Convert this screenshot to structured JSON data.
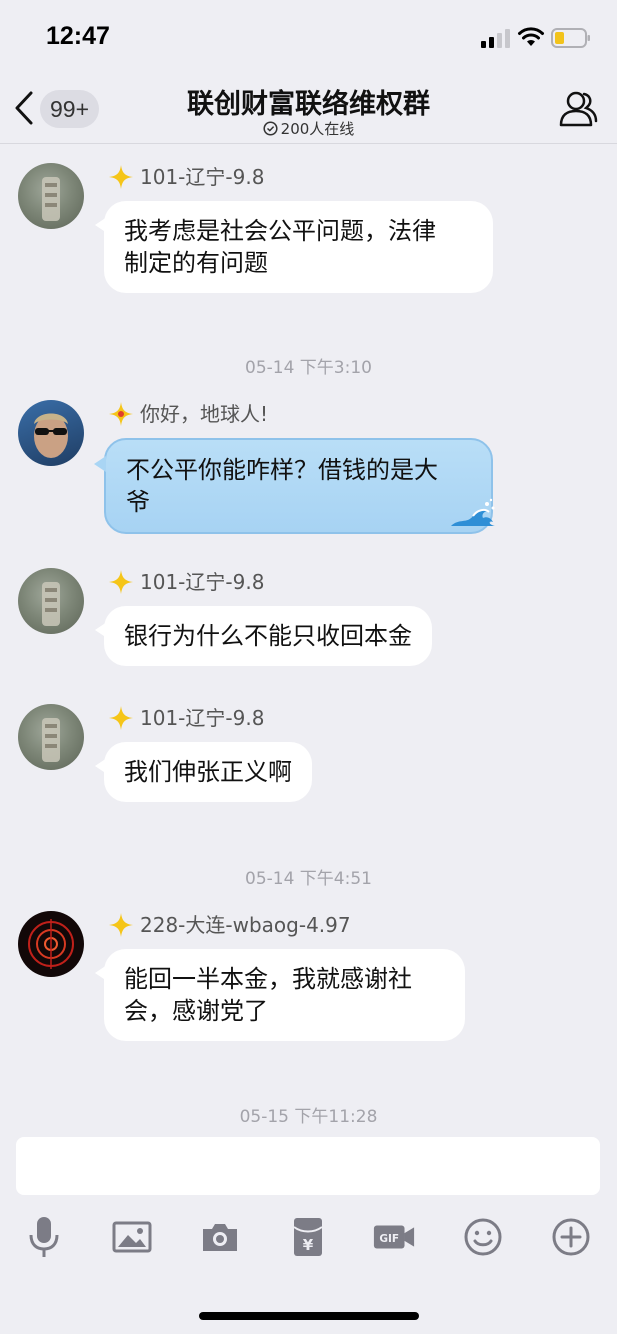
{
  "status_bar": {
    "time": "12:47"
  },
  "header": {
    "unread": "99+",
    "title": "联创财富联络维权群",
    "online": "200人在线"
  },
  "messages": [
    {
      "sender": "101-辽宁-9.8",
      "lines": [
        "我考虑是社会公平问题，法律",
        "制定的有问题"
      ],
      "style": "white"
    },
    {
      "timestamp": "05-14 下午3:10"
    },
    {
      "sender": "你好，地球人!",
      "lines": [
        "不公平你能咋样？借钱的是大",
        "爷"
      ],
      "style": "blue"
    },
    {
      "sender": "101-辽宁-9.8",
      "lines": [
        "银行为什么不能只收回本金"
      ],
      "style": "white"
    },
    {
      "sender": "101-辽宁-9.8",
      "lines": [
        "我们伸张正义啊"
      ],
      "style": "white"
    },
    {
      "timestamp": "05-14 下午4:51"
    },
    {
      "sender": "228-大连-wbaog-4.97",
      "lines": [
        "能回一半本金，我就感谢社",
        "会，感谢党了"
      ],
      "style": "white"
    },
    {
      "timestamp": "05-15 下午11:28"
    }
  ],
  "toolbar": {
    "items": [
      "microphone-icon",
      "image-icon",
      "camera-icon",
      "red-packet-icon",
      "gif-icon",
      "emoji-icon",
      "plus-icon"
    ]
  },
  "colors": {
    "background": "#eeeef3",
    "bubble": "#ffffff",
    "bubble_blue": "#b2dbf6",
    "timestamp": "#a3a3aa",
    "star": "#f5c518"
  }
}
